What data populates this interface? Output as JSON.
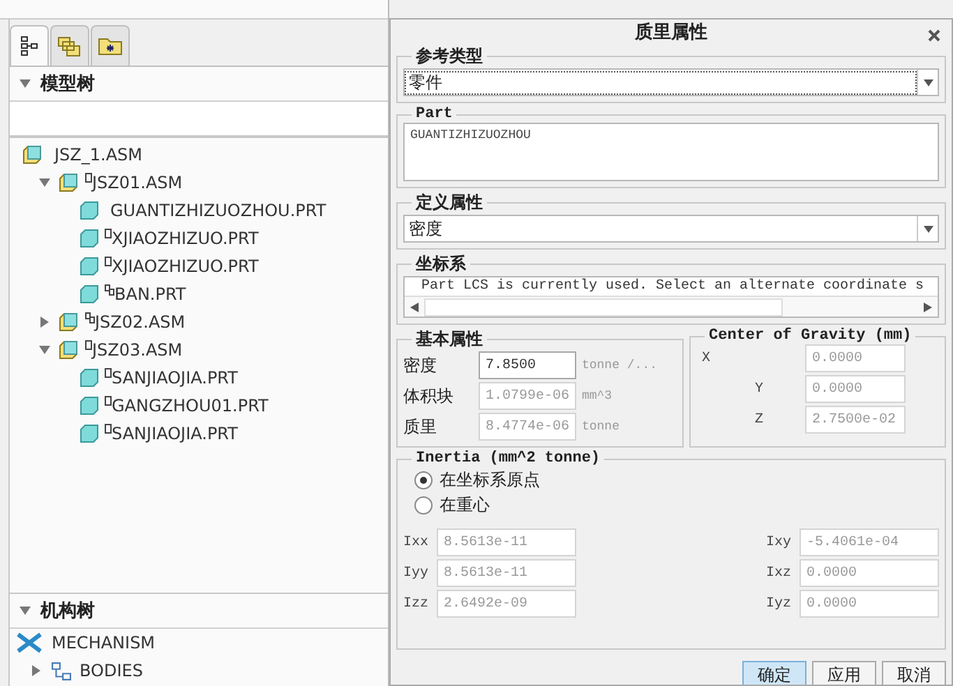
{
  "left_panel": {
    "tabs": [
      {
        "kind": "tree",
        "selected": true
      },
      {
        "kind": "layers",
        "selected": false
      },
      {
        "kind": "folder",
        "selected": false
      }
    ],
    "model_tree": {
      "title": "模型树",
      "items": [
        {
          "label": "JSZ_1.ASM",
          "kind": "assembly",
          "children": [
            {
              "label": "JSZ01.ASM",
              "kind": "assembly_box",
              "expanded": true,
              "children": [
                {
                  "label": "GUANTIZHIZUOZHOU.PRT",
                  "kind": "part"
                },
                {
                  "label": "XJIAOZHIZUO.PRT",
                  "kind": "part_box"
                },
                {
                  "label": "XJIAOZHIZUO.PRT",
                  "kind": "part_box"
                },
                {
                  "label": "BAN.PRT",
                  "kind": "part_linked"
                }
              ]
            },
            {
              "label": "JSZ02.ASM",
              "kind": "assembly_linked",
              "expanded": false
            },
            {
              "label": "JSZ03.ASM",
              "kind": "assembly_box",
              "expanded": true,
              "children": [
                {
                  "label": "SANJIAOJIA.PRT",
                  "kind": "part_box"
                },
                {
                  "label": "GANGZHOU01.PRT",
                  "kind": "part_box"
                },
                {
                  "label": "SANJIAOJIA.PRT",
                  "kind": "part_box"
                }
              ]
            }
          ]
        }
      ]
    },
    "mechanism_tree": {
      "title": "机构树",
      "items": [
        {
          "label": "MECHANISM",
          "kind": "mechanism"
        },
        {
          "label": "BODIES",
          "kind": "bodies"
        }
      ]
    }
  },
  "dialog": {
    "title": "质里属性",
    "reference_type": {
      "label": "参考类型",
      "value": "零件"
    },
    "part": {
      "label": "Part",
      "value": "GUANTIZHIZUOZHOU"
    },
    "define_property": {
      "label": "定义属性",
      "value": "密度"
    },
    "coordinate_system": {
      "label": "坐标系",
      "text": "Part LCS is currently used. Select an alternate coordinate s"
    },
    "basic_properties": {
      "label": "基本属性",
      "rows": [
        {
          "label": "密度",
          "value": "7.8500",
          "unit": "tonne /...",
          "editable": true
        },
        {
          "label": "体积块",
          "value": "1.0799e-06",
          "unit": "mm^3",
          "editable": false
        },
        {
          "label": "质里",
          "value": "8.4774e-06",
          "unit": "tonne",
          "editable": false
        }
      ]
    },
    "center_of_gravity": {
      "label": "Center of Gravity (mm)",
      "rows": [
        {
          "axis": "X",
          "value": "0.0000"
        },
        {
          "axis": "Y",
          "value": "0.0000"
        },
        {
          "axis": "Z",
          "value": "2.7500e-02"
        }
      ]
    },
    "inertia": {
      "label": "Inertia (mm^2 tonne)",
      "options": [
        {
          "label": "在坐标系原点",
          "selected": true
        },
        {
          "label": "在重心",
          "selected": false
        }
      ],
      "fields": [
        {
          "label": "Ixx",
          "value": "8.5613e-11"
        },
        {
          "label": "Ixy",
          "value": "-5.4061e-04"
        },
        {
          "label": "Iyy",
          "value": "8.5613e-11"
        },
        {
          "label": "Ixz",
          "value": "0.0000"
        },
        {
          "label": "Izz",
          "value": "2.6492e-09"
        },
        {
          "label": "Iyz",
          "value": "0.0000"
        }
      ]
    },
    "buttons": [
      {
        "label": "确定",
        "primary": true
      },
      {
        "label": "应用",
        "primary": false
      },
      {
        "label": "取消",
        "primary": false
      }
    ]
  }
}
